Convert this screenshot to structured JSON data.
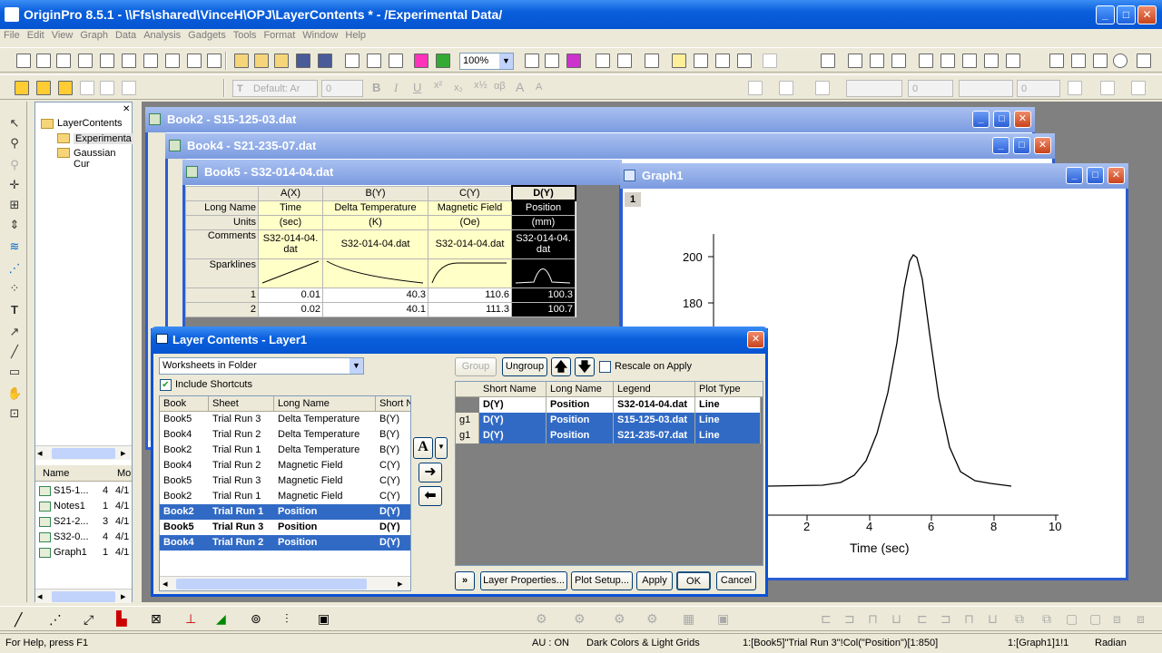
{
  "app": {
    "title": "OriginPro 8.5.1 - \\\\Ffs\\shared\\VinceH\\OPJ\\LayerContents * - /Experimental Data/"
  },
  "menu": [
    "File",
    "Edit",
    "View",
    "Graph",
    "Data",
    "Analysis",
    "Gadgets",
    "Tools",
    "Format",
    "Window",
    "Help"
  ],
  "toolbar": {
    "zoom": "100%",
    "font": "Default: Ar",
    "fontsize": "0",
    "linesize": "0",
    "fillsize": "0"
  },
  "project": {
    "tree": [
      "LayerContents",
      "Experimenta",
      "Gaussian Cur"
    ],
    "cols": [
      "Name",
      "Mo"
    ],
    "items": [
      {
        "name": "S15-1...",
        "a": "4",
        "b": "4/1"
      },
      {
        "name": "Notes1",
        "a": "1",
        "b": "4/1"
      },
      {
        "name": "S21-2...",
        "a": "3",
        "b": "4/1"
      },
      {
        "name": "S32-0...",
        "a": "4",
        "b": "4/1"
      },
      {
        "name": "Graph1",
        "a": "1",
        "b": "4/1"
      }
    ]
  },
  "windows": {
    "book2": "Book2 - S15-125-03.dat",
    "book4": "Book4 - S21-235-07.dat",
    "book5": "Book5 - S32-014-04.dat",
    "graph": "Graph1"
  },
  "sheet": {
    "cols": [
      "A(X)",
      "B(Y)",
      "C(Y)",
      "D(Y)"
    ],
    "rowlabels": [
      "Long Name",
      "Units",
      "Comments",
      "Sparklines"
    ],
    "longname": [
      "Time",
      "Delta Temperature",
      "Magnetic Field",
      "Position"
    ],
    "units": [
      "(sec)",
      "(K)",
      "(Oe)",
      "(mm)"
    ],
    "comments": [
      "S32-014-04.dat",
      "S32-014-04.dat",
      "S32-014-04.dat",
      "S32-014-04.dat"
    ],
    "rows": [
      [
        "1",
        "0.01",
        "40.3",
        "110.6",
        "100.3"
      ],
      [
        "2",
        "0.02",
        "40.1",
        "111.3",
        "100.7"
      ]
    ]
  },
  "graph": {
    "layer": "1",
    "xlabel": "Time (sec)",
    "xticks": [
      "2",
      "4",
      "6",
      "8",
      "10"
    ],
    "yticks": [
      "200",
      "180"
    ]
  },
  "dialog": {
    "title": "Layer Contents - Layer1",
    "filter": "Worksheets in Folder",
    "include_shortcuts": "Include Shortcuts",
    "left_headers": [
      "Book",
      "Sheet",
      "Long Name",
      "Short N"
    ],
    "left_rows": [
      [
        "Book5",
        "Trial Run 3",
        "Delta Temperature",
        "B(Y)"
      ],
      [
        "Book4",
        "Trial Run 2",
        "Delta Temperature",
        "B(Y)"
      ],
      [
        "Book2",
        "Trial Run 1",
        "Delta Temperature",
        "B(Y)"
      ],
      [
        "Book4",
        "Trial Run 2",
        "Magnetic Field",
        "C(Y)"
      ],
      [
        "Book5",
        "Trial Run 3",
        "Magnetic Field",
        "C(Y)"
      ],
      [
        "Book2",
        "Trial Run 1",
        "Magnetic Field",
        "C(Y)"
      ],
      [
        "Book2",
        "Trial Run 1",
        "Position",
        "D(Y)"
      ],
      [
        "Book5",
        "Trial Run 3",
        "Position",
        "D(Y)"
      ],
      [
        "Book4",
        "Trial Run 2",
        "Position",
        "D(Y)"
      ]
    ],
    "group": "Group",
    "ungroup": "Ungroup",
    "rescale": "Rescale on Apply",
    "right_headers": [
      "Short Name",
      "Long Name",
      "Legend",
      "Plot Type"
    ],
    "right_rows": [
      [
        "",
        "D(Y)",
        "Position",
        "S32-014-04.dat",
        "Line"
      ],
      [
        "g1",
        "D(Y)",
        "Position",
        "S15-125-03.dat",
        "Line"
      ],
      [
        "g1",
        "D(Y)",
        "Position",
        "S21-235-07.dat",
        "Line"
      ]
    ],
    "buttons": {
      "more": "»",
      "layer_props": "Layer Properties...",
      "plot_setup": "Plot Setup...",
      "apply": "Apply",
      "ok": "OK",
      "cancel": "Cancel"
    }
  },
  "status": {
    "help": "For Help, press F1",
    "au": "AU : ON",
    "theme": "Dark Colors & Light Grids",
    "cell": "1:[Book5]\"Trial Run 3\"!Col(\"Position\")[1:850]",
    "layer": "1:[Graph1]1!1",
    "angle": "Radian"
  }
}
